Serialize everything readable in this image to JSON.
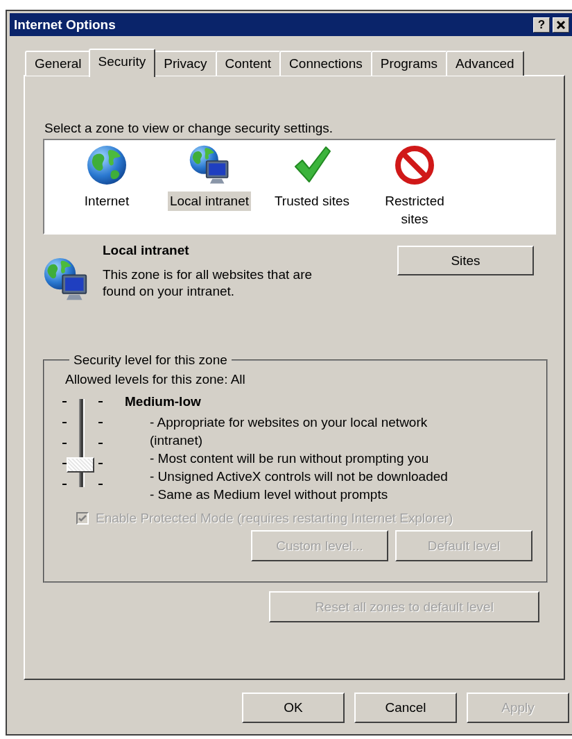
{
  "window": {
    "title": "Internet Options",
    "help_button": "?"
  },
  "tabs": [
    {
      "label": "General",
      "selected": false
    },
    {
      "label": "Security",
      "selected": true
    },
    {
      "label": "Privacy",
      "selected": false
    },
    {
      "label": "Content",
      "selected": false
    },
    {
      "label": "Connections",
      "selected": false
    },
    {
      "label": "Programs",
      "selected": false
    },
    {
      "label": "Advanced",
      "selected": false
    }
  ],
  "zones": {
    "prompt": "Select a zone to view or change security settings.",
    "items": [
      {
        "kind": "internet",
        "label": "Internet",
        "selected": false
      },
      {
        "kind": "intranet",
        "label": "Local intranet",
        "selected": true
      },
      {
        "kind": "trusted",
        "label": "Trusted sites",
        "selected": false
      },
      {
        "kind": "restricted",
        "label": "Restricted sites",
        "selected": false
      }
    ]
  },
  "zone_info": {
    "kind": "intranet",
    "title": "Local intranet",
    "description": "This zone is for all websites that are found on your intranet.",
    "button": "Sites"
  },
  "security_level": {
    "legend": "Security level for this zone",
    "allowed": "Allowed levels for this zone: All",
    "level": 0.25,
    "level_name": "Medium-low",
    "bullets": [
      "- Appropriate for websites on your local network (intranet)",
      "- Most content will be run without prompting you",
      "- Unsigned ActiveX controls will not be downloaded",
      "- Same as Medium level without prompts"
    ],
    "protected_mode": {
      "label": "Enable Protected Mode (requires restarting Internet Explorer)",
      "checked": true,
      "disabled": true
    },
    "buttons": [
      {
        "label": "Custom level...",
        "disabled": true
      },
      {
        "label": "Default level",
        "disabled": true
      }
    ]
  },
  "reset_button": {
    "label": "Reset all zones to default level",
    "disabled": true
  },
  "footer_buttons": [
    {
      "label": "OK",
      "disabled": false
    },
    {
      "label": "Cancel",
      "disabled": false
    },
    {
      "label": "Apply",
      "disabled": true
    }
  ]
}
